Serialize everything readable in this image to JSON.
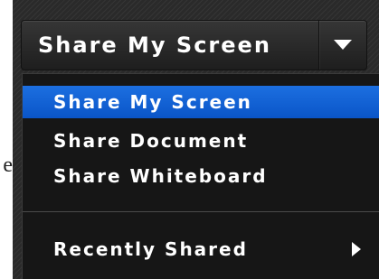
{
  "clipped_text": "e",
  "share_button": {
    "label": "Share My Screen",
    "toggle_icon": "triangle-down-icon"
  },
  "menu": {
    "items": [
      {
        "label": "Share My Screen",
        "selected": true
      },
      {
        "label": "Share Document",
        "selected": false
      },
      {
        "label": "Share Whiteboard",
        "selected": false
      }
    ],
    "recent": {
      "label": "Recently Shared",
      "icon": "triangle-right-icon"
    }
  },
  "colors": {
    "panel_bg": "#2a2a2a",
    "menu_bg": "#161616",
    "selection": "#1565d8",
    "text": "#ffffff"
  }
}
